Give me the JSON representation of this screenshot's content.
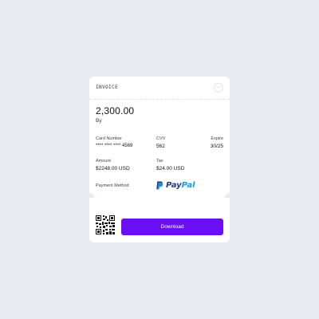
{
  "invoice": {
    "title": "INVOICE",
    "more_icon": "more-horizontal-icon",
    "more_glyph": "···",
    "amount": "2,300.00",
    "by_label": "By",
    "card_number_label": "Card Number",
    "card_number": "**** **** **** 4569",
    "cvv_label": "CVV",
    "cvv": "562",
    "expire_label": "Expire",
    "expire": "30/25",
    "amount_label": "Amount",
    "amount_value": "$2248.00 USD",
    "tax_label": "Tax",
    "tax_value": "$24.00 USD",
    "payment_method_label": "Payment Method",
    "payment_method_icon": "paypal-logo",
    "payment_method_pay": "Pay",
    "payment_method_pal": "Pal",
    "qr_icon": "qr-code-icon",
    "download_label": "Download"
  },
  "colors": {
    "background": "#e8ebf2",
    "card": "#ffffff",
    "accent": "#6a0ff5",
    "paypal_dark": "#253b80",
    "paypal_light": "#179bd7"
  }
}
